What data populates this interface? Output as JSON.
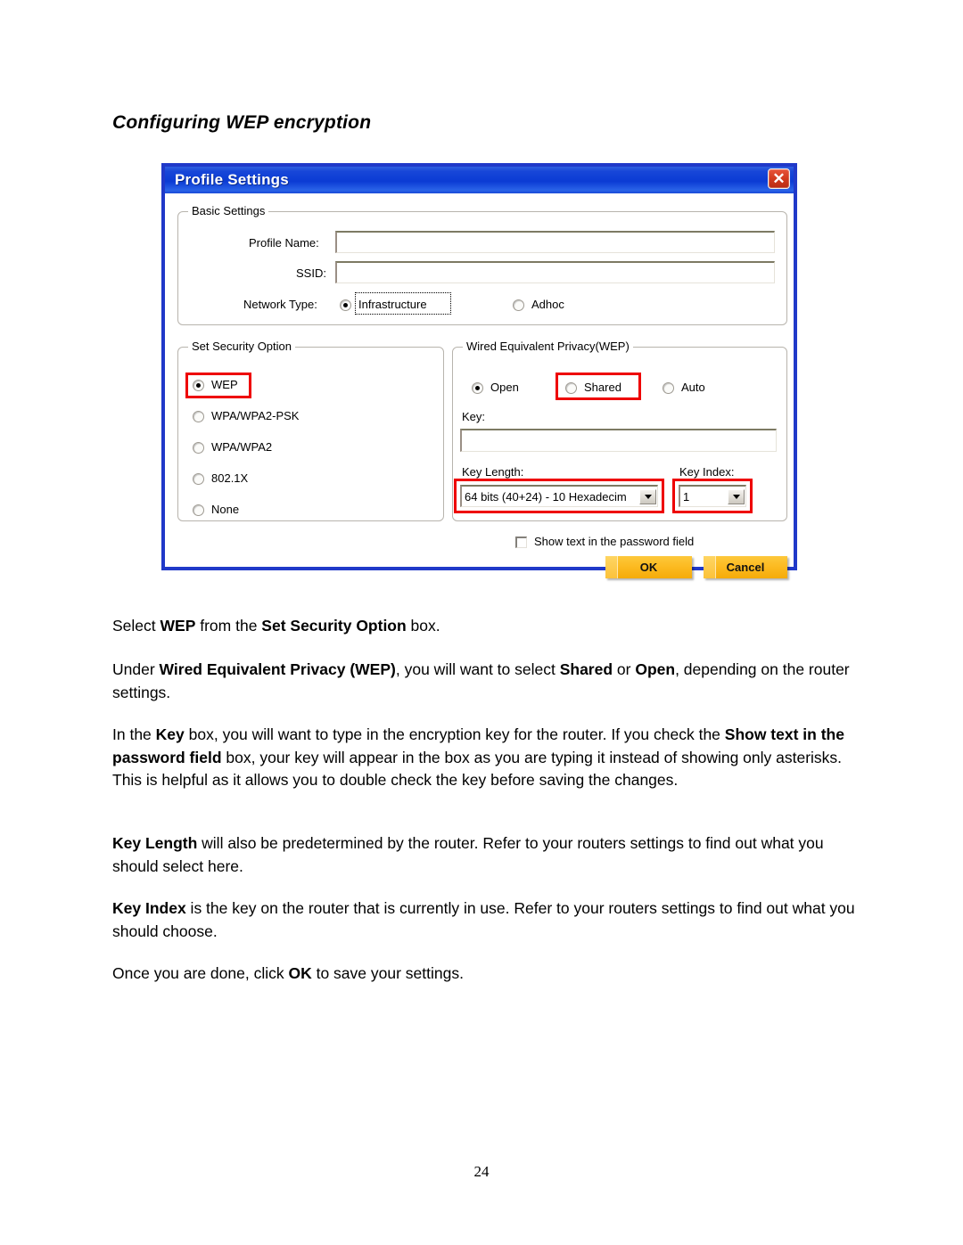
{
  "heading": "Configuring WEP encryption",
  "dialog": {
    "title": "Profile Settings",
    "close_label": "✕",
    "basic_settings": {
      "group_title": "Basic Settings",
      "profile_name_label": "Profile Name:",
      "profile_name_value": "",
      "ssid_label": "SSID:",
      "ssid_value": "",
      "network_type_label": "Network Type:",
      "network_type_options": [
        "Infrastructure",
        "Adhoc"
      ],
      "network_type_selected": "Infrastructure"
    },
    "security_option": {
      "group_title": "Set Security Option",
      "options": [
        "WEP",
        "WPA/WPA2-PSK",
        "WPA/WPA2",
        "802.1X",
        "None"
      ],
      "selected": "WEP"
    },
    "wep": {
      "group_title": "Wired Equivalent Privacy(WEP)",
      "auth_options": [
        "Open",
        "Shared",
        "Auto"
      ],
      "auth_selected": "Open",
      "key_label": "Key:",
      "key_value": "",
      "key_length_label": "Key Length:",
      "key_length_value": "64 bits (40+24) - 10 Hexadecim",
      "key_index_label": "Key Index:",
      "key_index_value": "1"
    },
    "show_text_label": "Show text in the password field",
    "show_text_checked": false,
    "ok_label": "OK",
    "cancel_label": "Cancel"
  },
  "paragraphs": {
    "p1_a": "Select ",
    "p1_b1": "WEP",
    "p1_c": " from the ",
    "p1_b2": "Set Security Option",
    "p1_d": " box.",
    "p2_a": "Under ",
    "p2_b1": "Wired Equivalent Privacy (WEP)",
    "p2_c": ", you will want to select ",
    "p2_b2": "Shared",
    "p2_d": " or ",
    "p2_b3": "Open",
    "p2_e": ", depending on the router settings.",
    "p3_a": "In the ",
    "p3_b1": "Key",
    "p3_c": " box, you will want to type in the encryption key for the router.  If you check the ",
    "p3_b2": "Show text in the password field",
    "p3_d": " box, your key will appear in the box as you are typing it instead of showing only asterisks.  This is helpful as it allows you to double check the key before saving the changes.",
    "p4_b1": "Key Length",
    "p4_a": " will also be predetermined by the router.  Refer to your routers settings to find out what you should select here.",
    "p5_b1": "Key Index",
    "p5_a": " is the key on the router that is currently in use.  Refer to your routers settings to find out what you should choose.",
    "p6_a": "Once you are done, click ",
    "p6_b1": "OK",
    "p6_c": " to save your settings."
  },
  "page_number": "24",
  "colors": {
    "titlebar_blue": "#0b3bd4",
    "dialog_border": "#2039c9",
    "annotation_red": "#ee0000",
    "button_gold": "#fcbb22"
  }
}
